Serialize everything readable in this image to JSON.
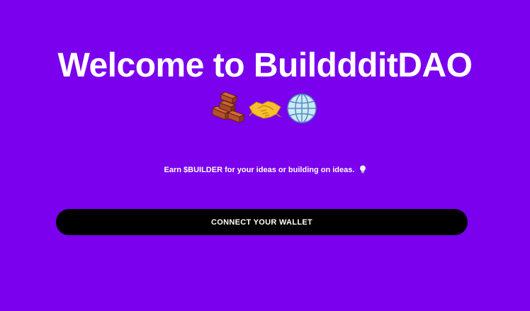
{
  "hero": {
    "title": "Welcome to BuilddditDAO",
    "emojis": [
      "bricks-icon",
      "handshake-icon",
      "globe-icon"
    ]
  },
  "tagline": {
    "text": "Earn $BUILDER for your ideas or building on ideas.",
    "icon": "lightbulb-icon"
  },
  "connect": {
    "label": "CONNECT YOUR WALLET"
  },
  "colors": {
    "background": "#7a00ee",
    "button": "#000000",
    "text": "#ffffff"
  }
}
